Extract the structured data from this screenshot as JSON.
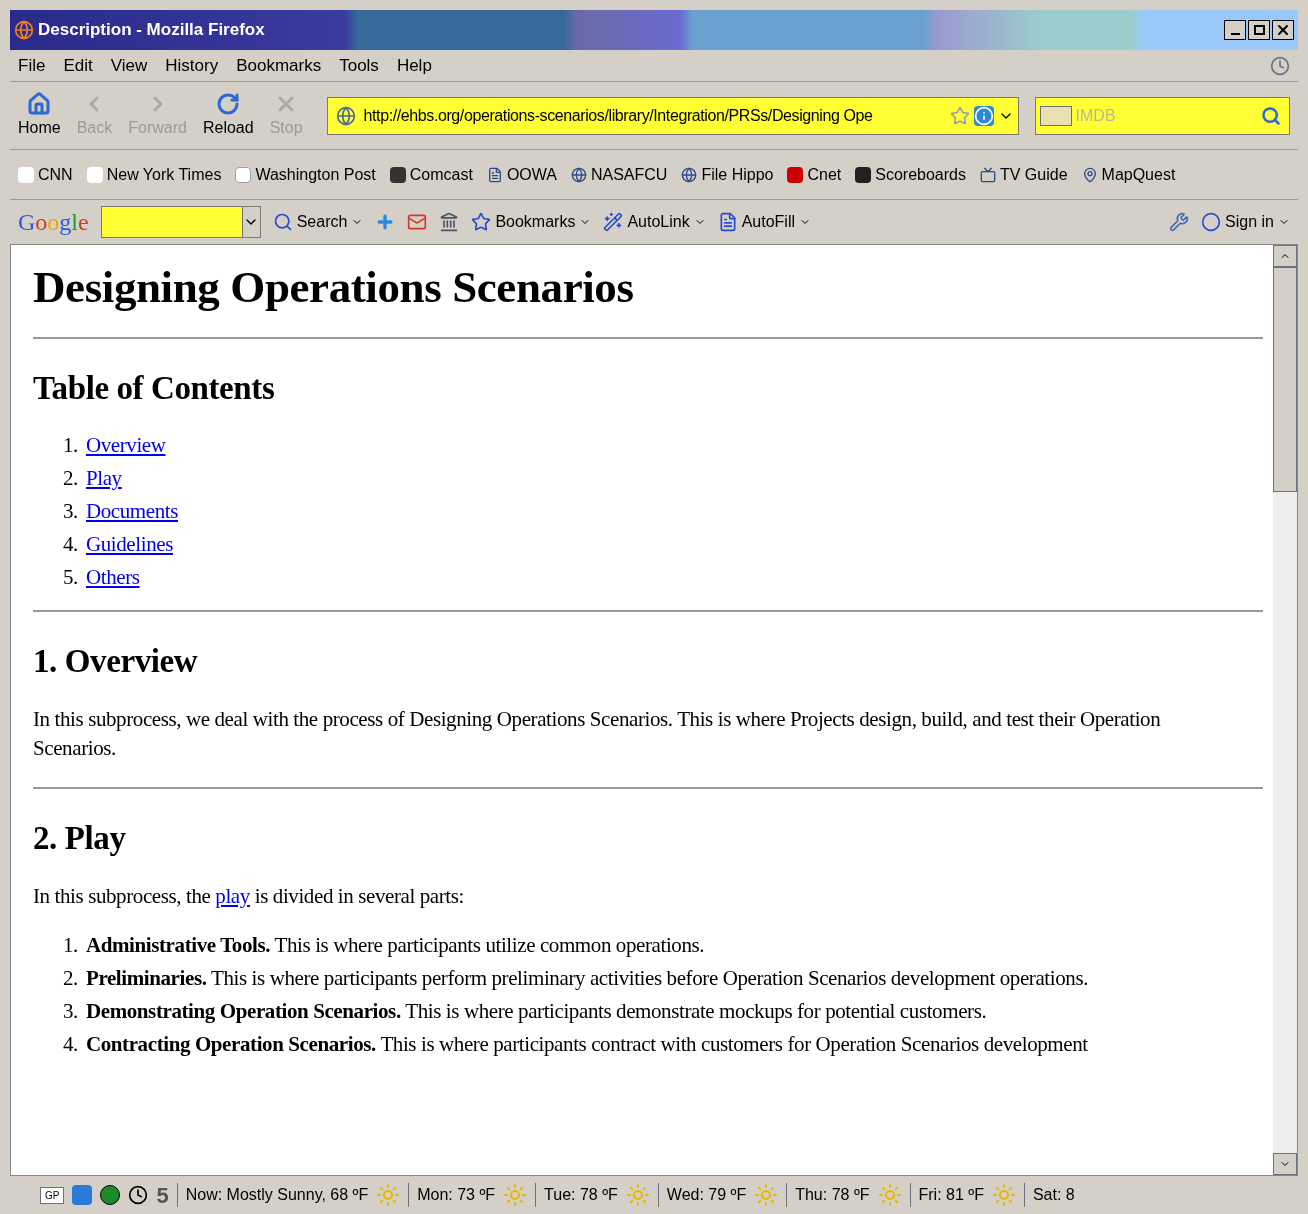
{
  "window": {
    "title": "Description - Mozilla Firefox"
  },
  "menu": [
    "File",
    "Edit",
    "View",
    "History",
    "Bookmarks",
    "Tools",
    "Help"
  ],
  "nav_buttons": [
    {
      "label": "Home",
      "kind": "home",
      "disabled": false
    },
    {
      "label": "Back",
      "kind": "back",
      "disabled": true
    },
    {
      "label": "Forward",
      "kind": "forward",
      "disabled": true
    },
    {
      "label": "Reload",
      "kind": "reload",
      "disabled": false
    },
    {
      "label": "Stop",
      "kind": "stop",
      "disabled": true
    }
  ],
  "address_bar": {
    "value": "http://ehbs.org/operations-scenarios/library/Integration/PRSs/Designing Ope"
  },
  "search_bar": {
    "placeholder": "IMDB"
  },
  "bookmarks": [
    {
      "label": "CNN",
      "kind": "cnn"
    },
    {
      "label": "New York Times",
      "kind": "nyt"
    },
    {
      "label": "Washington Post",
      "kind": "wp"
    },
    {
      "label": "Comcast",
      "kind": "comcast"
    },
    {
      "label": "OOWA",
      "kind": "page"
    },
    {
      "label": "NASAFCU",
      "kind": "nasa"
    },
    {
      "label": "File Hippo",
      "kind": "hippo"
    },
    {
      "label": "Cnet",
      "kind": "cnet"
    },
    {
      "label": "Scoreboards",
      "kind": "si"
    },
    {
      "label": "TV Guide",
      "kind": "tv"
    },
    {
      "label": "MapQuest",
      "kind": "map"
    }
  ],
  "google_toolbar": {
    "logo": "Google",
    "items": [
      {
        "label": "Search",
        "kind": "search"
      },
      {
        "label": "Bookmarks",
        "kind": "bookmarks"
      },
      {
        "label": "AutoLink",
        "kind": "autolink"
      },
      {
        "label": "AutoFill",
        "kind": "autofill"
      },
      {
        "label": "Sign in",
        "kind": "signin"
      }
    ]
  },
  "page": {
    "title": "Designing Operations Scenarios",
    "toc": {
      "heading": "Table of Contents",
      "items": [
        {
          "number": "1.",
          "label": "Overview"
        },
        {
          "number": "2.",
          "label": "Play"
        },
        {
          "number": "3.",
          "label": "Documents"
        },
        {
          "number": "4.",
          "label": "Guidelines"
        },
        {
          "number": "5.",
          "label": "Others"
        }
      ]
    },
    "sections": [
      {
        "heading": "1. Overview",
        "paragraph": "In this subprocess, we deal with the process of Designing Operations Scenarios. This is where Projects design, build, and test their Operation Scenarios."
      },
      {
        "heading": "2. Play",
        "intro_before": "In this subprocess, the",
        "intro_link": "play",
        "intro_after": "is divided in several parts:",
        "items": [
          {
            "number": "1.",
            "term": "Administrative Tools.",
            "text": "This is where participants utilize common operations."
          },
          {
            "number": "2.",
            "term": "Preliminaries.",
            "text": "This is where participants perform preliminary activities before Operation Scenarios development operations."
          },
          {
            "number": "3.",
            "term": "Demonstrating Operation Scenarios.",
            "text": "This is where participants demonstrate mockups for potential customers."
          },
          {
            "number": "4.",
            "term": "Contracting Operation Scenarios.",
            "text": "This is where participants contract with customers for Operation Scenarios development"
          }
        ]
      }
    ]
  },
  "status_bar": {
    "badge": "GP",
    "count": "5",
    "weather": [
      "Now: Mostly Sunny, 68 ºF",
      "Mon: 73 ºF",
      "Tue: 78 ºF",
      "Wed: 79 ºF",
      "Thu: 78 ºF",
      "Fri: 81 ºF",
      "Sat: 8"
    ]
  }
}
